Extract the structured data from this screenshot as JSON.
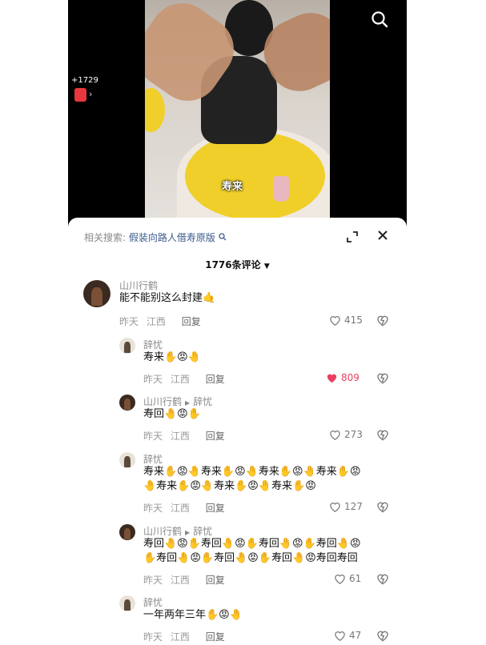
{
  "video": {
    "caption": "寿来",
    "coin_count": "+1729",
    "redpack_arrow": "›"
  },
  "sheet": {
    "related_label": "相关搜索:",
    "related_query": "假装向路人借寿原版",
    "comment_count": "1776条评论"
  },
  "comments": [
    {
      "name": "山川行鹤",
      "reply_to": "",
      "text": "能不能别这么封建🤙",
      "date": "昨天",
      "region": "江西",
      "reply": "回复",
      "likes": "415",
      "liked": false
    },
    {
      "name": "辞忧",
      "reply_to": "",
      "text": "寿来✋😡🤚",
      "date": "昨天",
      "region": "江西",
      "reply": "回复",
      "likes": "809",
      "liked": true
    },
    {
      "name": "山川行鹤",
      "reply_to": "辞忧",
      "text": "寿回🤚😡✋",
      "date": "昨天",
      "region": "江西",
      "reply": "回复",
      "likes": "273",
      "liked": false
    },
    {
      "name": "辞忧",
      "reply_to": "",
      "text1": "寿来✋😡🤚寿来✋😡🤚寿来✋😡🤚寿来✋😡",
      "text2": "🤚寿来✋😡🤚寿来✋😡🤚寿来✋😡",
      "date": "昨天",
      "region": "江西",
      "reply": "回复",
      "likes": "127",
      "liked": false
    },
    {
      "name": "山川行鹤",
      "reply_to": "辞忧",
      "text1": "寿回🤚😡✋寿回🤚😡✋寿回🤚😡✋寿回🤚😡",
      "text2": "✋寿回🤚😡✋寿回🤚😡✋寿回🤚😡寿回寿回",
      "date": "昨天",
      "region": "江西",
      "reply": "回复",
      "likes": "61",
      "liked": false
    },
    {
      "name": "辞忧",
      "reply_to": "",
      "text": "一年两年三年✋😡🤚",
      "date": "昨天",
      "region": "江西",
      "reply": "回复",
      "likes": "47",
      "liked": false
    }
  ],
  "colors": {
    "accent": "#ea3f5e",
    "link": "#3a5a8c",
    "yellow": "#f0cf2a"
  }
}
